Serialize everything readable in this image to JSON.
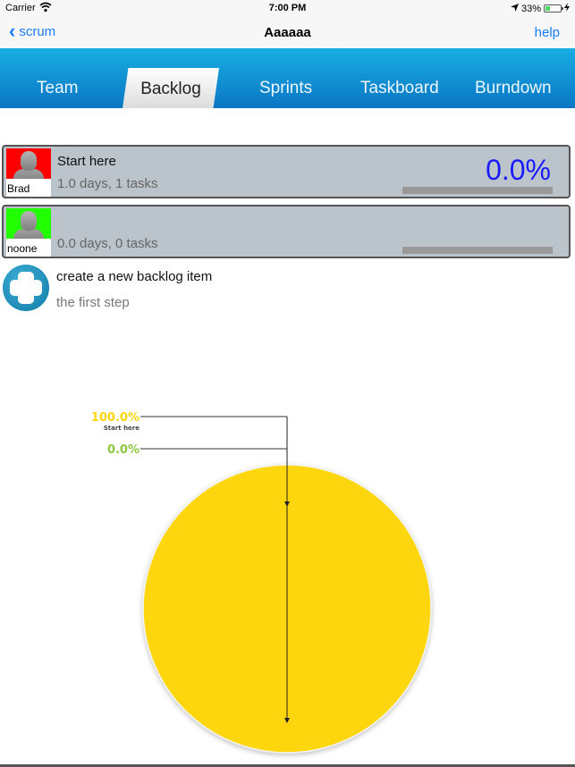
{
  "status_bar": {
    "carrier": "Carrier",
    "wifi_icon": "wifi-icon",
    "time": "7:00 PM",
    "location_icon": "location-arrow-icon",
    "battery_percent": "33%",
    "battery_level": 0.33,
    "charging_icon": "bolt-icon"
  },
  "nav": {
    "back_label": "scrum",
    "title": "Aaaaaa",
    "help_label": "help"
  },
  "tabs": [
    {
      "label": "Team",
      "active": false
    },
    {
      "label": "Backlog",
      "active": true
    },
    {
      "label": "Sprints",
      "active": false
    },
    {
      "label": "Taskboard",
      "active": false
    },
    {
      "label": "Burndown",
      "active": false
    }
  ],
  "backlog_items": [
    {
      "owner": "Brad",
      "owner_color": "#ff0000",
      "title": "Start here",
      "summary": "1.0 days, 1 tasks",
      "percent_label": "0.0%",
      "progress": 0.0
    },
    {
      "owner": "noone",
      "owner_color": "#22ff00",
      "title": "",
      "summary": "0.0 days, 0 tasks",
      "percent_label": "",
      "progress": 0.0
    }
  ],
  "create_item": {
    "title": "create a new backlog item",
    "subtitle": "the first step"
  },
  "chart_data": {
    "type": "pie",
    "title": "",
    "slices": [
      {
        "label": "Start here",
        "value": 100.0,
        "value_label": "100.0%",
        "color": "#fdd60a"
      },
      {
        "label": "",
        "value": 0.0,
        "value_label": "0.0%",
        "color": "#8dc63f"
      }
    ],
    "legend": "callouts-top-left"
  }
}
